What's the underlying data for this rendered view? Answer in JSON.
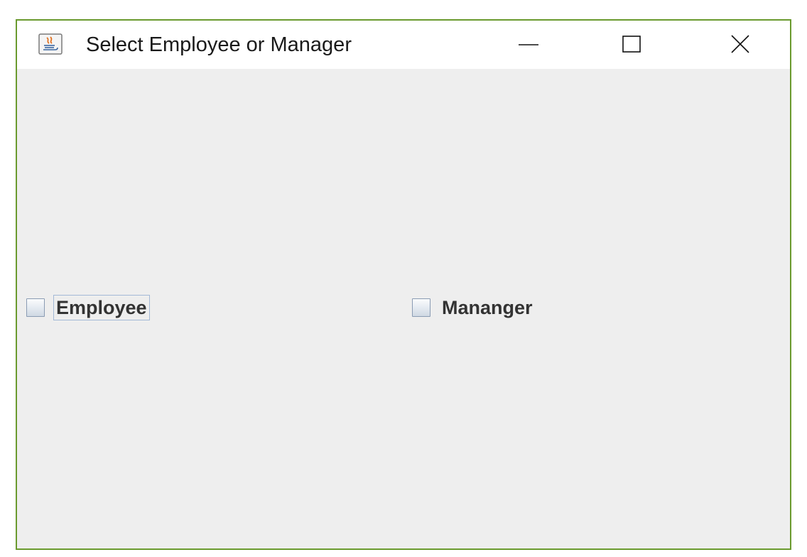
{
  "window": {
    "title": "Select Employee or Manager",
    "border_color": "#6a9a2e",
    "controls": {
      "minimize_icon": "minimize-icon",
      "maximize_icon": "maximize-icon",
      "close_icon": "close-icon"
    }
  },
  "content": {
    "checkboxes": [
      {
        "label": "Employee",
        "checked": false,
        "focused": true
      },
      {
        "label": "Mananger",
        "checked": false,
        "focused": false
      }
    ]
  }
}
